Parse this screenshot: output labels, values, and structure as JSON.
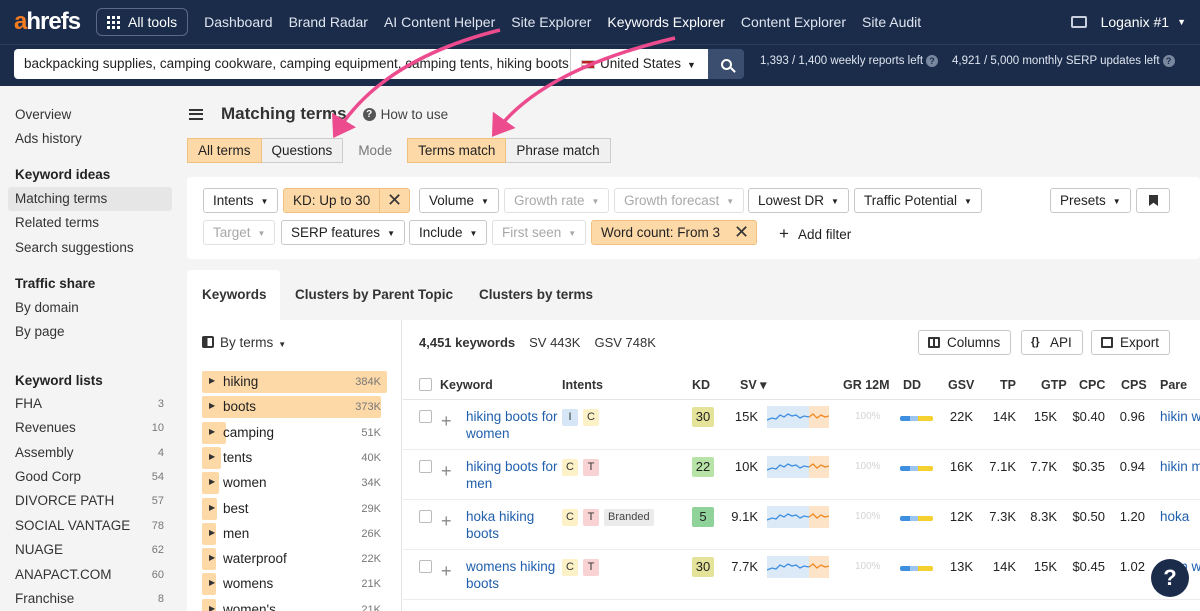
{
  "topnav": {
    "logo_a": "a",
    "logo_rest": "hrefs",
    "all_tools": "All tools",
    "links": [
      "Dashboard",
      "Brand Radar",
      "AI Content Helper",
      "Site Explorer",
      "Keywords Explorer",
      "Content Explorer",
      "Site Audit"
    ],
    "active_link": "Keywords Explorer",
    "account": "Loganix #1"
  },
  "search": {
    "query": "backpacking supplies, camping cookware, camping equipment, camping tents, hiking boots, h",
    "country": "United States",
    "weekly_reports": "1,393  /  1,400  weekly reports left",
    "monthly_serp": "4,921  /  5,000  monthly SERP updates left"
  },
  "sidebar": {
    "top_items": [
      "Overview",
      "Ads history"
    ],
    "keyword_ideas_heading": "Keyword ideas",
    "keyword_ideas": [
      "Matching terms",
      "Related terms",
      "Search suggestions"
    ],
    "traffic_share_heading": "Traffic share",
    "traffic_share": [
      "By domain",
      "By page"
    ],
    "keyword_lists_heading": "Keyword lists",
    "keyword_lists": [
      {
        "name": "FHA",
        "count": "3"
      },
      {
        "name": "Revenues",
        "count": "10"
      },
      {
        "name": "Assembly",
        "count": "4"
      },
      {
        "name": "Good Corp",
        "count": "54"
      },
      {
        "name": "DIVORCE PATH",
        "count": "57"
      },
      {
        "name": "SOCIAL VANTAGE",
        "count": "78"
      },
      {
        "name": "NUAGE",
        "count": "62"
      },
      {
        "name": "ANAPACT.COM",
        "count": "60"
      },
      {
        "name": "Franchise",
        "count": "8"
      }
    ]
  },
  "page": {
    "title": "Matching terms",
    "how_to_use": "How to use",
    "seg_all_terms": "All terms",
    "seg_questions": "Questions",
    "mode_label": "Mode",
    "seg_terms_match": "Terms match",
    "seg_phrase_match": "Phrase match"
  },
  "filters": {
    "intents": "Intents",
    "kd": "KD: Up to 30",
    "volume": "Volume",
    "growth_rate": "Growth rate",
    "growth_forecast": "Growth forecast",
    "lowest_dr": "Lowest DR",
    "traffic_potential": "Traffic Potential",
    "presets": "Presets",
    "target": "Target",
    "serp_features": "SERP features",
    "include": "Include",
    "first_seen": "First seen",
    "word_count": "Word count: From 3",
    "add_filter": "Add filter",
    "close_glyph": "✕"
  },
  "tabs": [
    "Keywords",
    "Clusters by Parent Topic",
    "Clusters by terms"
  ],
  "terms_panel": {
    "by_terms": "By terms",
    "terms": [
      {
        "name": "hiking",
        "count": "384K",
        "share": 1.0
      },
      {
        "name": "boots",
        "count": "373K",
        "share": 0.97
      },
      {
        "name": "camping",
        "count": "51K",
        "share": 0.13
      },
      {
        "name": "tents",
        "count": "40K",
        "share": 0.1
      },
      {
        "name": "women",
        "count": "34K",
        "share": 0.09
      },
      {
        "name": "best",
        "count": "29K",
        "share": 0.08
      },
      {
        "name": "men",
        "count": "26K",
        "share": 0.07
      },
      {
        "name": "waterproof",
        "count": "22K",
        "share": 0.06
      },
      {
        "name": "womens",
        "count": "21K",
        "share": 0.05
      },
      {
        "name": "women's",
        "count": "21K",
        "share": 0.05
      }
    ]
  },
  "summary": {
    "keywords": "4,451 keywords",
    "sv": "SV 443K",
    "gsv": "GSV 748K",
    "columns_btn": "Columns",
    "api_btn": "API",
    "export_btn": "Export"
  },
  "table": {
    "headers": {
      "keyword": "Keyword",
      "intents": "Intents",
      "kd": "KD",
      "sv": "SV ▾",
      "gr": "GR 12M",
      "dd": "DD",
      "gsv": "GSV",
      "tp": "TP",
      "gtp": "GTP",
      "cpc": "CPC",
      "cps": "CPS",
      "parent": "Pare"
    },
    "rows": [
      {
        "keyword": "hiking boots for women",
        "intents": [
          "I",
          "C"
        ],
        "kd": "30",
        "kd_color": "#e5e39a",
        "sv": "15K",
        "gr": "100%",
        "gsv": "22K",
        "tp": "14K",
        "gtp": "15K",
        "cpc": "$0.40",
        "cps": "0.96",
        "parent": "hikin wom"
      },
      {
        "keyword": "hiking boots for men",
        "intents": [
          "C",
          "T"
        ],
        "kd": "22",
        "kd_color": "#b8e3a6",
        "sv": "10K",
        "gr": "100%",
        "gsv": "16K",
        "tp": "7.1K",
        "gtp": "7.7K",
        "cpc": "$0.35",
        "cps": "0.94",
        "parent": "hikin men"
      },
      {
        "keyword": "hoka hiking boots",
        "intents": [
          "C",
          "T",
          "Branded"
        ],
        "kd": "5",
        "kd_color": "#8fd39b",
        "sv": "9.1K",
        "gr": "100%",
        "gsv": "12K",
        "tp": "7.3K",
        "gtp": "8.3K",
        "cpc": "$0.50",
        "cps": "1.20",
        "parent": "hoka"
      },
      {
        "keyword": "womens hiking boots",
        "intents": [
          "C",
          "T"
        ],
        "kd": "30",
        "kd_color": "#e5e39a",
        "sv": "7.7K",
        "gr": "100%",
        "gsv": "13K",
        "tp": "14K",
        "gtp": "15K",
        "cpc": "$0.45",
        "cps": "1.02",
        "parent": "hikin wom"
      }
    ]
  },
  "help": "?"
}
